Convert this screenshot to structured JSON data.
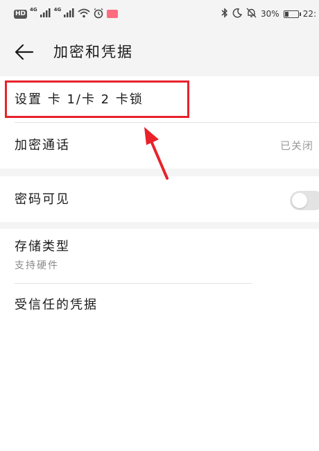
{
  "status_bar": {
    "hd_badge": "HD",
    "network_1": "4G",
    "network_2": "4G",
    "battery_percent": "30%",
    "battery_level": 0.3,
    "time": "22:",
    "icons": [
      "hd-icon",
      "signal-icon",
      "signal-icon",
      "wifi-icon",
      "alarm-icon",
      "notification-icon",
      "bluetooth-icon",
      "moon-icon",
      "mute-icon",
      "battery-icon"
    ]
  },
  "header": {
    "back_icon": "arrow-left-icon",
    "title": "加密和凭据"
  },
  "list": {
    "sim_lock": {
      "title": "设置 卡 1/卡 2 卡锁"
    },
    "encrypted_call": {
      "title": "加密通话",
      "value": "已关闭"
    },
    "password_visible": {
      "title": "密码可见",
      "toggle_on": false
    },
    "storage_type": {
      "title": "存储类型",
      "subtitle": "支持硬件"
    },
    "trusted_credentials": {
      "title": "受信任的凭据"
    }
  },
  "annotation": {
    "color": "#e8212b"
  }
}
